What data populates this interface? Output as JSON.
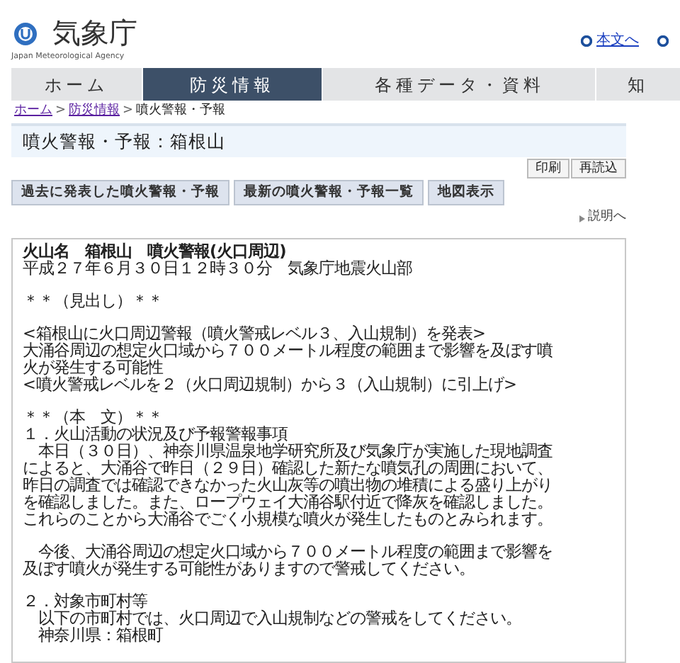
{
  "header": {
    "logo": {
      "name": "気象庁",
      "subtitle": "Japan Meteorological Agency"
    },
    "skip_link": "本文へ"
  },
  "nav": {
    "tabs": [
      {
        "label": "ホーム",
        "selected": false
      },
      {
        "label": "防災情報",
        "selected": true
      },
      {
        "label": "各種データ・資料",
        "selected": false
      },
      {
        "label": "知",
        "selected": false
      }
    ]
  },
  "breadcrumb": [
    {
      "label": "ホーム",
      "kind": "link"
    },
    {
      "separator": ">",
      "label": "防災情報",
      "kind": "link"
    },
    {
      "separator": ">",
      "label": "噴火警報・予報",
      "kind": "current"
    }
  ],
  "page_title": "噴火警報・予報：箱根山",
  "tools": [
    "印刷",
    "再読込"
  ],
  "actions": [
    "過去に発表した噴火警報・予報",
    "最新の噴火警報・予報一覧",
    "地図表示"
  ],
  "help_link": "説明へ",
  "bulletin": {
    "heading": "火山名　箱根山　噴火警報(火口周辺)",
    "paragraphs": [
      {
        "lines": [
          "平成２７年６月３０日１２時３０分　気象庁地震火山部"
        ]
      },
      {
        "lines": [
          "＊＊（見出し）＊＊"
        ]
      },
      {
        "lines": [
          "<箱根山に火口周辺警報（噴火警戒レベル３、入山規制）を発表>",
          "大涌谷周辺の想定火口域から７００メートル程度の範囲まで影響を及ぼす噴",
          "火が発生する可能性",
          "<噴火警戒レベルを２（火口周辺規制）から３（入山規制）に引上げ>"
        ]
      },
      {
        "lines": [
          "＊＊（本　文）＊＊",
          "１．火山活動の状況及び予報警報事項",
          "　本日（３０日）、神奈川県温泉地学研究所及び気象庁が実施した現地調査",
          "によると、大涌谷で昨日（２９日）確認した新たな噴気孔の周囲において、",
          "昨日の調査では確認できなかった火山灰等の噴出物の堆積による盛り上がり",
          "を確認しました。また、ロープウェイ大涌谷駅付近で降灰を確認しました。",
          "これらのことから大涌谷でごく小規模な噴火が発生したものとみられます。"
        ]
      },
      {
        "lines": [
          "　今後、大涌谷周辺の想定火口域から７００メートル程度の範囲まで影響を",
          "及ぼす噴火が発生する可能性がありますので警戒してください。"
        ]
      },
      {
        "lines": [
          "２．対象市町村等",
          "　以下の市町村では、火口周辺で入山規制などの警戒をしてください。",
          "　神奈川県：箱根町"
        ]
      }
    ]
  }
}
